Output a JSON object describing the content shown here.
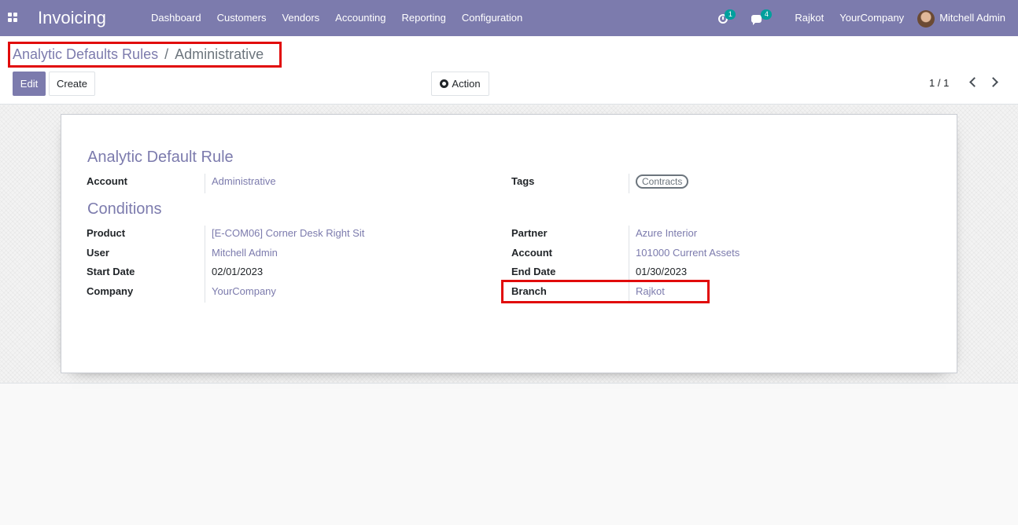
{
  "navbar": {
    "app_name": "Invoicing",
    "menu": [
      "Dashboard",
      "Customers",
      "Vendors",
      "Accounting",
      "Reporting",
      "Configuration"
    ],
    "activity_count": "1",
    "message_count": "4",
    "branch": "Rajkot",
    "company": "YourCompany",
    "user": "Mitchell Admin",
    "color": "#7c7bad"
  },
  "breadcrumb": {
    "parent": "Analytic Defaults Rules",
    "separator": "/",
    "current": "Administrative"
  },
  "buttons": {
    "edit": "Edit",
    "create": "Create",
    "action": "Action"
  },
  "pager": {
    "value": "1 / 1"
  },
  "form": {
    "section1_title": "Analytic Default Rule",
    "account_label": "Account",
    "account_value": "Administrative",
    "tags_label": "Tags",
    "tags": [
      "Contracts"
    ],
    "section2_title": "Conditions",
    "left_fields": [
      {
        "label": "Product",
        "value": "[E-COM06] Corner Desk Right Sit"
      },
      {
        "label": "User",
        "value": "Mitchell Admin"
      },
      {
        "label": "Start Date",
        "value": "02/01/2023"
      },
      {
        "label": "Company",
        "value": "YourCompany"
      }
    ],
    "right_fields": [
      {
        "label": "Partner",
        "value": "Azure Interior"
      },
      {
        "label": "Account",
        "value": "101000 Current Assets"
      },
      {
        "label": "End Date",
        "value": "01/30/2023"
      },
      {
        "label": "Branch",
        "value": "Rajkot"
      }
    ]
  },
  "highlight_color": "#e10b0b"
}
